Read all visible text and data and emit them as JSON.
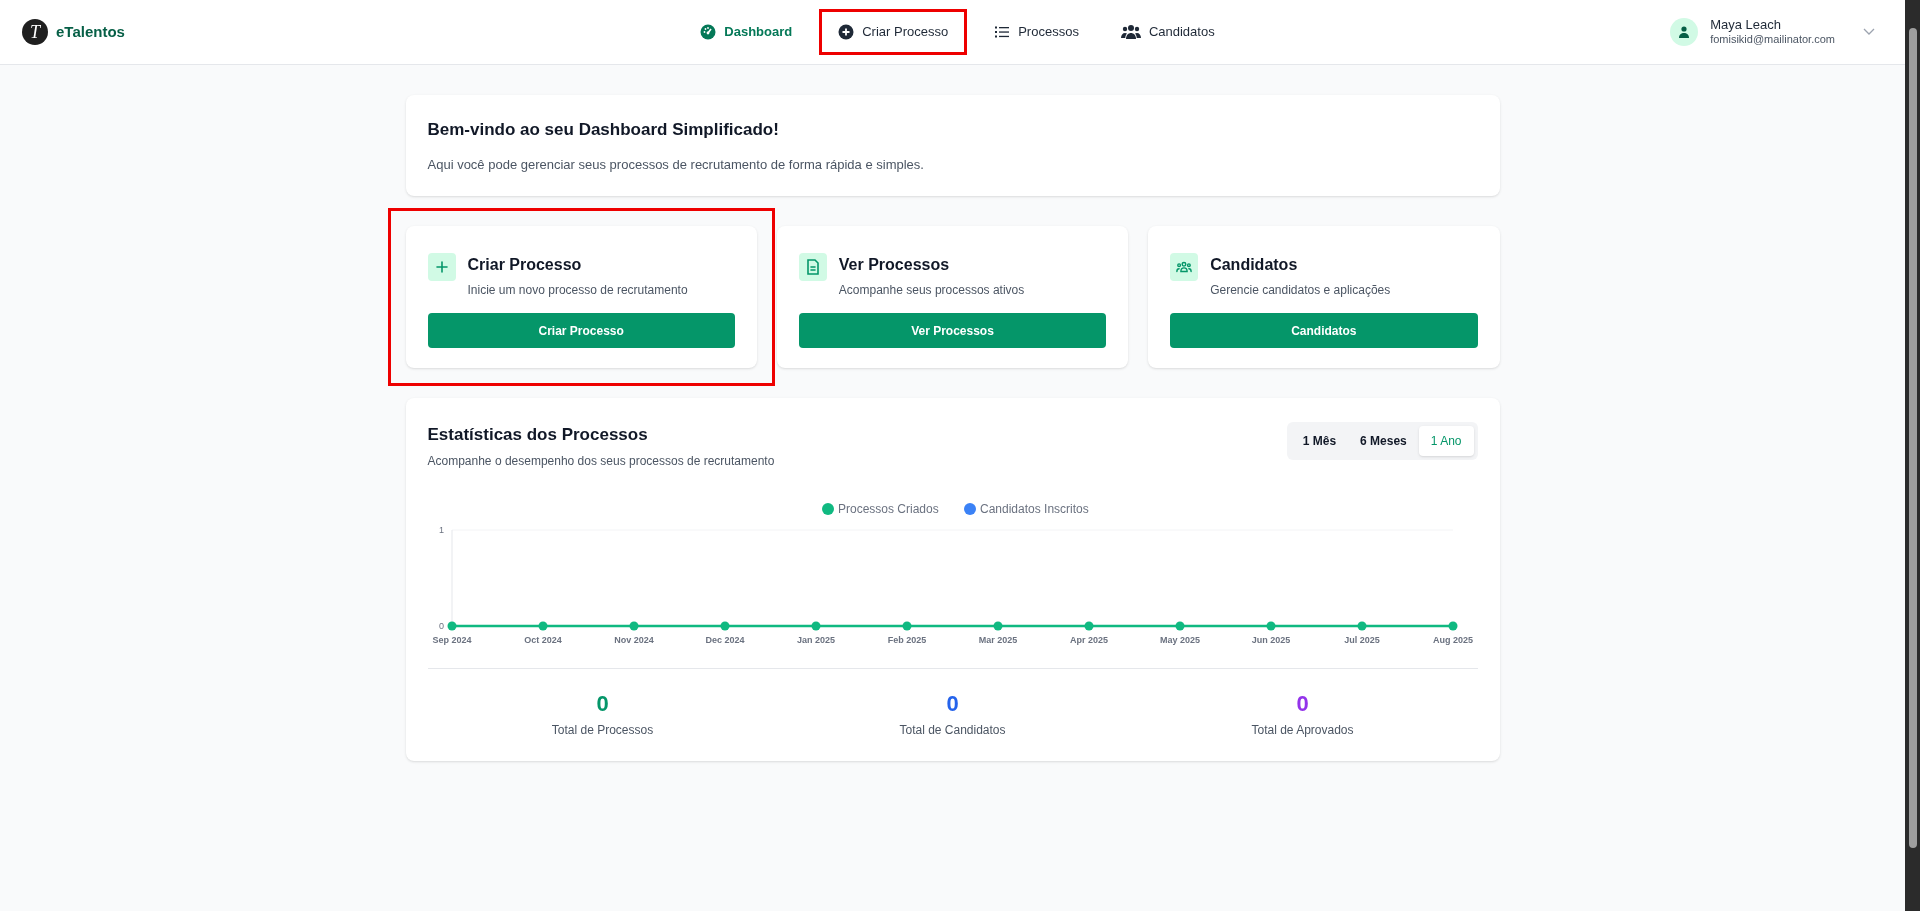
{
  "brand": {
    "name": "eTalentos",
    "logo_letter": "T"
  },
  "nav": [
    {
      "label": "Dashboard",
      "kind": "gauge",
      "selected": true,
      "highlighted": false
    },
    {
      "label": "Criar Processo",
      "kind": "plus-circle",
      "selected": false,
      "highlighted": true
    },
    {
      "label": "Processos",
      "kind": "list",
      "selected": false,
      "highlighted": false
    },
    {
      "label": "Candidatos",
      "kind": "users",
      "selected": false,
      "highlighted": false
    }
  ],
  "user": {
    "name": "Maya Leach",
    "email": "fomisikid@mailinator.com"
  },
  "welcome": {
    "title": "Bem-vindo ao seu Dashboard Simplificado!",
    "text": "Aqui você pode gerenciar seus processos de recrutamento de forma rápida e simples."
  },
  "actions": [
    {
      "kind": "plus",
      "title": "Criar Processo",
      "text": "Inicie um novo processo de recrutamento",
      "button": "Criar Processo",
      "highlighted": true
    },
    {
      "kind": "document",
      "title": "Ver Processos",
      "text": "Acompanhe seus processos ativos",
      "button": "Ver Processos",
      "highlighted": false
    },
    {
      "kind": "users",
      "title": "Candidatos",
      "text": "Gerencie candidatos e aplicações",
      "button": "Candidatos",
      "highlighted": false
    }
  ],
  "stats": {
    "title": "Estatísticas dos Processos",
    "subtitle": "Acompanhe o desempenho dos seus processos de recrutamento",
    "periods": [
      {
        "label": "1 Mês",
        "selected": false
      },
      {
        "label": "6 Meses",
        "selected": false
      },
      {
        "label": "1 Ano",
        "selected": true
      }
    ],
    "chart_data": {
      "type": "line",
      "legend": "top",
      "categories": [
        "Sep 2024",
        "Oct 2024",
        "Nov 2024",
        "Dec 2024",
        "Jan 2025",
        "Feb 2025",
        "Mar 2025",
        "Apr 2025",
        "May 2025",
        "Jun 2025",
        "Jul 2025",
        "Aug 2025"
      ],
      "series": [
        {
          "name": "Processos Criados",
          "color": "#10b981",
          "marker": "circle",
          "values": [
            0,
            0,
            0,
            0,
            0,
            0,
            0,
            0,
            0,
            0,
            0,
            0
          ]
        },
        {
          "name": "Candidatos Inscritos",
          "color": "#3b82f6",
          "marker": "circle",
          "values": [
            null,
            null,
            null,
            null,
            null,
            null,
            null,
            null,
            null,
            null,
            null,
            null
          ]
        }
      ],
      "ylim": [
        0,
        1
      ],
      "yticks": [
        0,
        1
      ]
    },
    "totals": [
      {
        "value": "0",
        "label": "Total de Processos",
        "color": "#059669"
      },
      {
        "value": "0",
        "label": "Total de Candidatos",
        "color": "#2563eb"
      },
      {
        "value": "0",
        "label": "Total de Aprovados",
        "color": "#9333ea"
      }
    ]
  }
}
